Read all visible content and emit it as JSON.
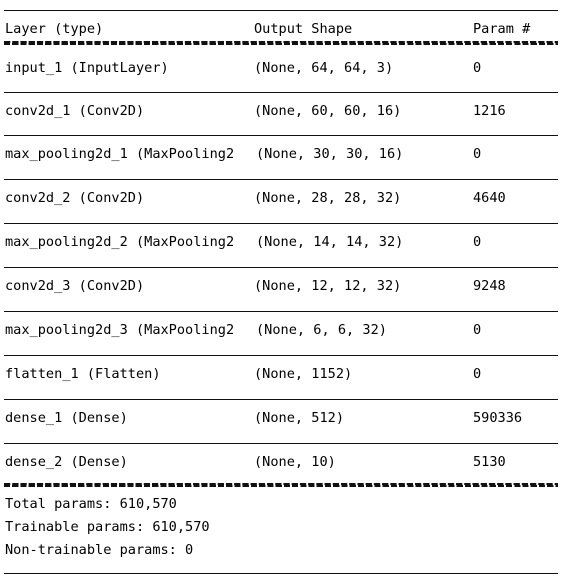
{
  "table": {
    "headers": {
      "layer": "Layer (type)",
      "output_shape": "Output Shape",
      "param": "Param #"
    },
    "rows": [
      {
        "layer": "input_1 (InputLayer)",
        "shape": "(None, 64, 64, 3)",
        "param": "0",
        "overflow": false
      },
      {
        "layer": "conv2d_1 (Conv2D)",
        "shape": "(None, 60, 60, 16)",
        "param": "1216",
        "overflow": false
      },
      {
        "layer": "max_pooling2d_1 (MaxPooling2",
        "shape": "(None, 30, 30, 16)",
        "param": "0",
        "overflow": true
      },
      {
        "layer": "conv2d_2 (Conv2D)",
        "shape": "(None, 28, 28, 32)",
        "param": "4640",
        "overflow": false
      },
      {
        "layer": "max_pooling2d_2 (MaxPooling2",
        "shape": "(None, 14, 14, 32)",
        "param": "0",
        "overflow": true
      },
      {
        "layer": "conv2d_3 (Conv2D)",
        "shape": "(None, 12, 12, 32)",
        "param": "9248",
        "overflow": false
      },
      {
        "layer": "max_pooling2d_3 (MaxPooling2",
        "shape": "(None, 6, 6, 32)",
        "param": "0",
        "overflow": true
      },
      {
        "layer": "flatten_1 (Flatten)",
        "shape": "(None, 1152)",
        "param": "0",
        "overflow": false
      },
      {
        "layer": "dense_1 (Dense)",
        "shape": "(None, 512)",
        "param": "590336",
        "overflow": false
      },
      {
        "layer": "dense_2 (Dense)",
        "shape": "(None, 10)",
        "param": "5130",
        "overflow": false
      }
    ]
  },
  "totals": {
    "total_params": "Total params: 610,570",
    "trainable_params": "Trainable params: 610,570",
    "non_trainable_params": "Non-trainable params: 0"
  },
  "colors": {
    "text": "#000000",
    "rule": "#111111",
    "background": "#ffffff"
  }
}
